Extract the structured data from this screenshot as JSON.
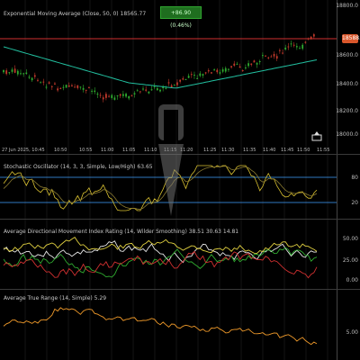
{
  "colors": {
    "background": "#000000",
    "grid": "#2a2a2a",
    "candle_up": "#2faa2f",
    "candle_down": "#c0392b",
    "ema": "#22c0a0",
    "hline": "#d03030",
    "stoch_k": "#d8c030",
    "stoch_d": "#3fa0ff",
    "adx": "#e6e6e6",
    "pdi": "#2faa2f",
    "mdi": "#d03030",
    "atr": "#f09a2a"
  },
  "main_panel": {
    "label": "Exponential Moving Average (Close, 50, 0)  18565.77",
    "badge": "+86.90 (0.46%)",
    "price_tag": "18588.4",
    "axis_ticks": [
      "18800.0",
      "18600.0",
      "18400.0",
      "18200.0",
      "18000.0"
    ]
  },
  "time_axis": {
    "ticks": [
      "27 Jun 2025, 10:45",
      "10:50",
      "10:55",
      "11:00",
      "11:05",
      "11:10",
      "11:15",
      "11:20",
      "11:25",
      "11:30",
      "11:35",
      "11:40",
      "11:45",
      "11:50",
      "11:55"
    ]
  },
  "stoch_panel": {
    "label": "Stochastic Oscillator (14, 3, 3, Simple, Low/High)  63.65",
    "axis_ticks": [
      "80",
      "20"
    ]
  },
  "adx_panel": {
    "label": "Average Directional Movement Index Rating (14, Wilder Smoothing)  38.51  30.63  14.81",
    "axis_ticks": [
      "50.00",
      "25.00",
      "0.00"
    ]
  },
  "atr_panel": {
    "label": "Average True Range (14, Simple)  5.29",
    "axis_ticks": [
      "5.00"
    ]
  },
  "icons": {
    "watermark": "logo-watermark",
    "scroll": "scroll-to-latest-icon"
  }
}
